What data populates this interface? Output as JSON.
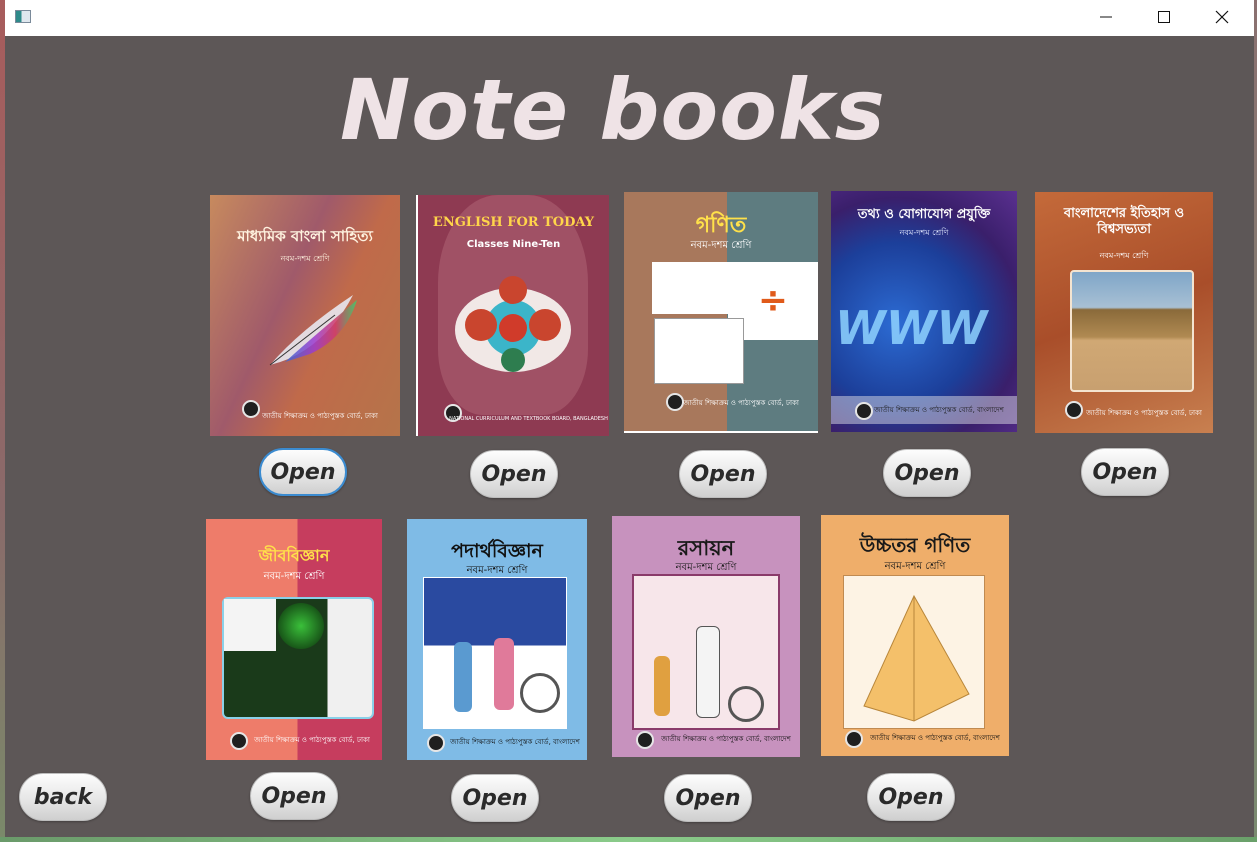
{
  "window": {
    "controls": {
      "minimize_icon": "minimize-icon",
      "maximize_icon": "maximize-icon",
      "close_icon": "close-icon"
    }
  },
  "page": {
    "title": "Note books"
  },
  "books": [
    {
      "title": "মাধ্যমিক বাংলা সাহিত্য",
      "subtitle": "নবম-দশম শ্রেণি",
      "footer": "জাতীয় শিক্ষাক্রম ও পাঠ্যপুস্তক বোর্ড, ঢাকা",
      "open_label": "Open"
    },
    {
      "title": "ENGLISH FOR TODAY",
      "subtitle": "Classes Nine-Ten",
      "footer": "NATIONAL CURRICULUM AND TEXTBOOK BOARD, BANGLADESH",
      "open_label": "Open"
    },
    {
      "title": "গণিত",
      "subtitle": "নবম-দশম শ্রেণি",
      "footer": "জাতীয় শিক্ষাক্রম ও পাঠ্যপুস্তক বোর্ড, ঢাকা",
      "open_label": "Open"
    },
    {
      "title": "তথ্য ও যোগাযোগ প্রযুক্তি",
      "subtitle": "নবম-দশম শ্রেণি",
      "footer": "জাতীয় শিক্ষাক্রম ও পাঠ্যপুস্তক বোর্ড, বাংলাদেশ",
      "open_label": "Open"
    },
    {
      "title": "বাংলাদেশের ইতিহাস ও বিশ্বসভ্যতা",
      "subtitle": "নবম-দশম শ্রেণি",
      "footer": "জাতীয় শিক্ষাক্রম ও পাঠ্যপুস্তক বোর্ড, ঢাকা",
      "open_label": "Open"
    },
    {
      "title": "জীববিজ্ঞান",
      "subtitle": "নবম-দশম শ্রেণি",
      "footer": "জাতীয় শিক্ষাক্রম ও পাঠ্যপুস্তক বোর্ড, ঢাকা",
      "open_label": "Open"
    },
    {
      "title": "পদার্থবিজ্ঞান",
      "subtitle": "নবম-দশম শ্রেণি",
      "footer": "জাতীয় শিক্ষাক্রম ও পাঠ্যপুস্তক বোর্ড, বাংলাদেশ",
      "open_label": "Open"
    },
    {
      "title": "রসায়ন",
      "subtitle": "নবম-দশম শ্রেণি",
      "footer": "জাতীয় শিক্ষাক্রম ও পাঠ্যপুস্তক বোর্ড, বাংলাদেশ",
      "open_label": "Open"
    },
    {
      "title": "উচ্চতর গণিত",
      "subtitle": "নবম-দশম শ্রেণি",
      "footer": "জাতীয় শিক্ষাক্রম ও পাঠ্যপুস্তক বোর্ড, বাংলাদেশ",
      "open_label": "Open"
    }
  ],
  "back_label": "back",
  "colors": {
    "background": "#5d5757",
    "title": "#efe3e6",
    "focus_ring": "#3b8bd0"
  }
}
